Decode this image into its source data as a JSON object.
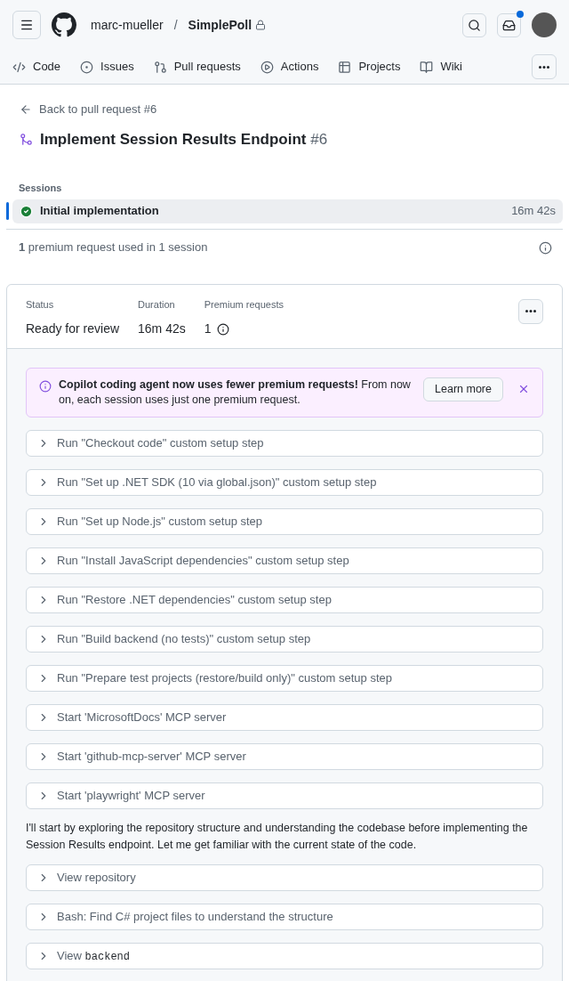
{
  "header": {
    "owner": "marc-mueller",
    "separator": "/",
    "repo": "SimplePoll",
    "notification_unread": true
  },
  "nav": [
    {
      "label": "Code"
    },
    {
      "label": "Issues"
    },
    {
      "label": "Pull requests"
    },
    {
      "label": "Actions"
    },
    {
      "label": "Projects"
    },
    {
      "label": "Wiki"
    }
  ],
  "back_link": "Back to pull request #6",
  "title": {
    "text": "Implement Session Results Endpoint",
    "number": "#6"
  },
  "sessions": {
    "heading": "Sessions",
    "items": [
      {
        "name": "Initial implementation",
        "duration": "16m 42s",
        "selected": true,
        "completed": true
      }
    ]
  },
  "summary": "**1** premium request used in 1 session",
  "stats": [
    {
      "label": "Status",
      "value": "Ready for review"
    },
    {
      "label": "Duration",
      "value": "16m 42s"
    },
    {
      "label": "Premium requests",
      "value": "1",
      "info": true
    }
  ],
  "banner": {
    "text": "**Copilot coding agent now uses fewer premium requests!** From now on, each session uses just one premium request.",
    "button": "Learn more"
  },
  "log": [
    {
      "kind": "step",
      "label": "Run \"Checkout code\" custom setup step",
      "expanded": false
    },
    {
      "kind": "step",
      "label": "Run \"Set up .NET SDK (10 via global.json)\" custom setup step",
      "expanded": false
    },
    {
      "kind": "step",
      "label": "Run \"Set up Node.js\" custom setup step",
      "expanded": false
    },
    {
      "kind": "step",
      "label": "Run \"Install JavaScript dependencies\" custom setup step",
      "expanded": false
    },
    {
      "kind": "step",
      "label": "Run \"Restore .NET dependencies\" custom setup step",
      "expanded": false
    },
    {
      "kind": "step",
      "label": "Run \"Build backend (no tests)\" custom setup step",
      "expanded": false
    },
    {
      "kind": "step",
      "label": "Run \"Prepare test projects (restore/build only)\" custom setup step",
      "expanded": false
    },
    {
      "kind": "step",
      "label": "Start 'MicrosoftDocs' MCP server",
      "expanded": false
    },
    {
      "kind": "step",
      "label": "Start 'github-mcp-server' MCP server",
      "expanded": false
    },
    {
      "kind": "step",
      "label": "Start 'playwright' MCP server",
      "expanded": false
    },
    {
      "kind": "message",
      "text": "I'll start by exploring the repository structure and understanding the codebase before implementing the Session Results endpoint. Let me get familiar with the current state of the code."
    },
    {
      "kind": "step",
      "label": "View repository",
      "expanded": false
    },
    {
      "kind": "step",
      "label": "Bash: Find C# project files to understand the structure",
      "expanded": false
    },
    {
      "kind": "step",
      "label": "View",
      "code": "backend",
      "expanded": false
    }
  ]
}
